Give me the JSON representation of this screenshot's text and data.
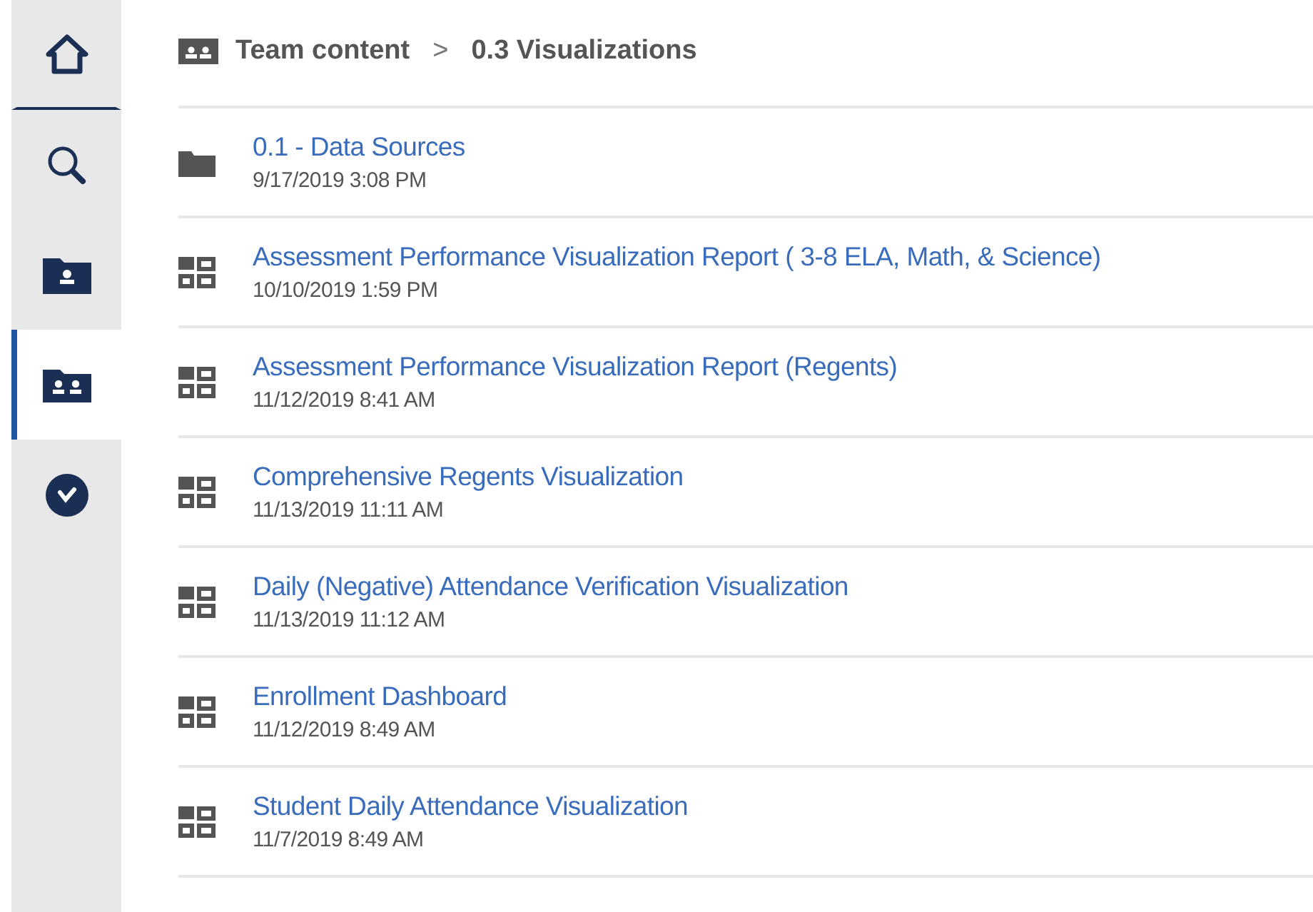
{
  "sidebar": {
    "items": [
      {
        "kind": "home",
        "selected": false
      },
      {
        "kind": "search",
        "selected": false
      },
      {
        "kind": "my-content",
        "selected": false
      },
      {
        "kind": "team-content",
        "selected": true
      },
      {
        "kind": "recent",
        "selected": false
      }
    ]
  },
  "breadcrumb": {
    "items": [
      "Team content",
      "0.3 Visualizations"
    ],
    "separator": ">"
  },
  "entries": [
    {
      "kind": "folder",
      "title": "0.1 - Data Sources",
      "date": "9/17/2019 3:08 PM"
    },
    {
      "kind": "dashboard",
      "title": "Assessment Performance Visualization Report ( 3-8 ELA, Math, & Science)",
      "date": "10/10/2019 1:59 PM"
    },
    {
      "kind": "dashboard",
      "title": "Assessment Performance Visualization Report (Regents)",
      "date": "11/12/2019 8:41 AM"
    },
    {
      "kind": "dashboard",
      "title": "Comprehensive Regents Visualization",
      "date": "11/13/2019 11:11 AM"
    },
    {
      "kind": "dashboard",
      "title": "Daily (Negative) Attendance Verification Visualization",
      "date": "11/13/2019 11:12 AM"
    },
    {
      "kind": "dashboard",
      "title": "Enrollment Dashboard",
      "date": "11/12/2019 8:49 AM"
    },
    {
      "kind": "dashboard",
      "title": "Student Daily Attendance Visualization",
      "date": "11/7/2019 8:49 AM"
    }
  ]
}
